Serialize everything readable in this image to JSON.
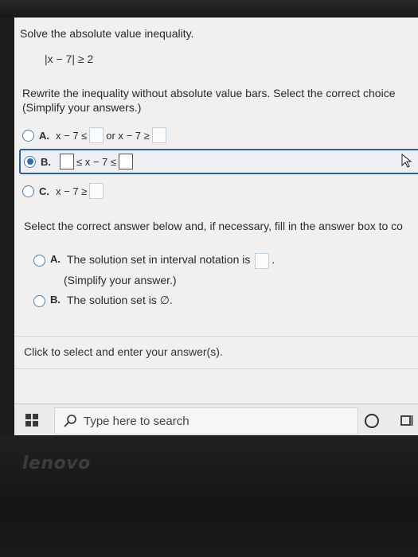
{
  "question": {
    "prompt": "Solve the absolute value inequality.",
    "expression": "|x − 7| ≥ 2"
  },
  "rewrite": {
    "instruction_line1": "Rewrite the inequality without absolute value bars. Select the correct choice",
    "instruction_line2": "(Simplify your answers.)",
    "options": [
      {
        "letter": "A.",
        "part1": "x − 7 ≤",
        "part2": "or x − 7 ≥",
        "selected": false
      },
      {
        "letter": "B.",
        "part1": "≤ x − 7 ≤",
        "selected": true
      },
      {
        "letter": "C.",
        "part1": "x − 7 ≥",
        "selected": false
      }
    ]
  },
  "answer": {
    "instruction": "Select the correct answer below and, if necessary, fill in the answer box to co",
    "option_a_letter": "A.",
    "option_a_text": "The solution set in interval notation is",
    "option_a_sub": "(Simplify your answer.)",
    "option_b_letter": "B.",
    "option_b_text": "The solution set is ∅."
  },
  "hint": "Click to select and enter your answer(s).",
  "taskbar": {
    "search_placeholder": "Type here to search"
  },
  "brand": "lenovo",
  "colors": {
    "accent": "#2d6bb0",
    "selected_border": "#2d5f9c",
    "screen_bg": "#f1f0ef"
  },
  "icons": [
    "windows-start-icon",
    "search-icon",
    "cortana-icon",
    "task-view-icon",
    "cursor-icon"
  ]
}
